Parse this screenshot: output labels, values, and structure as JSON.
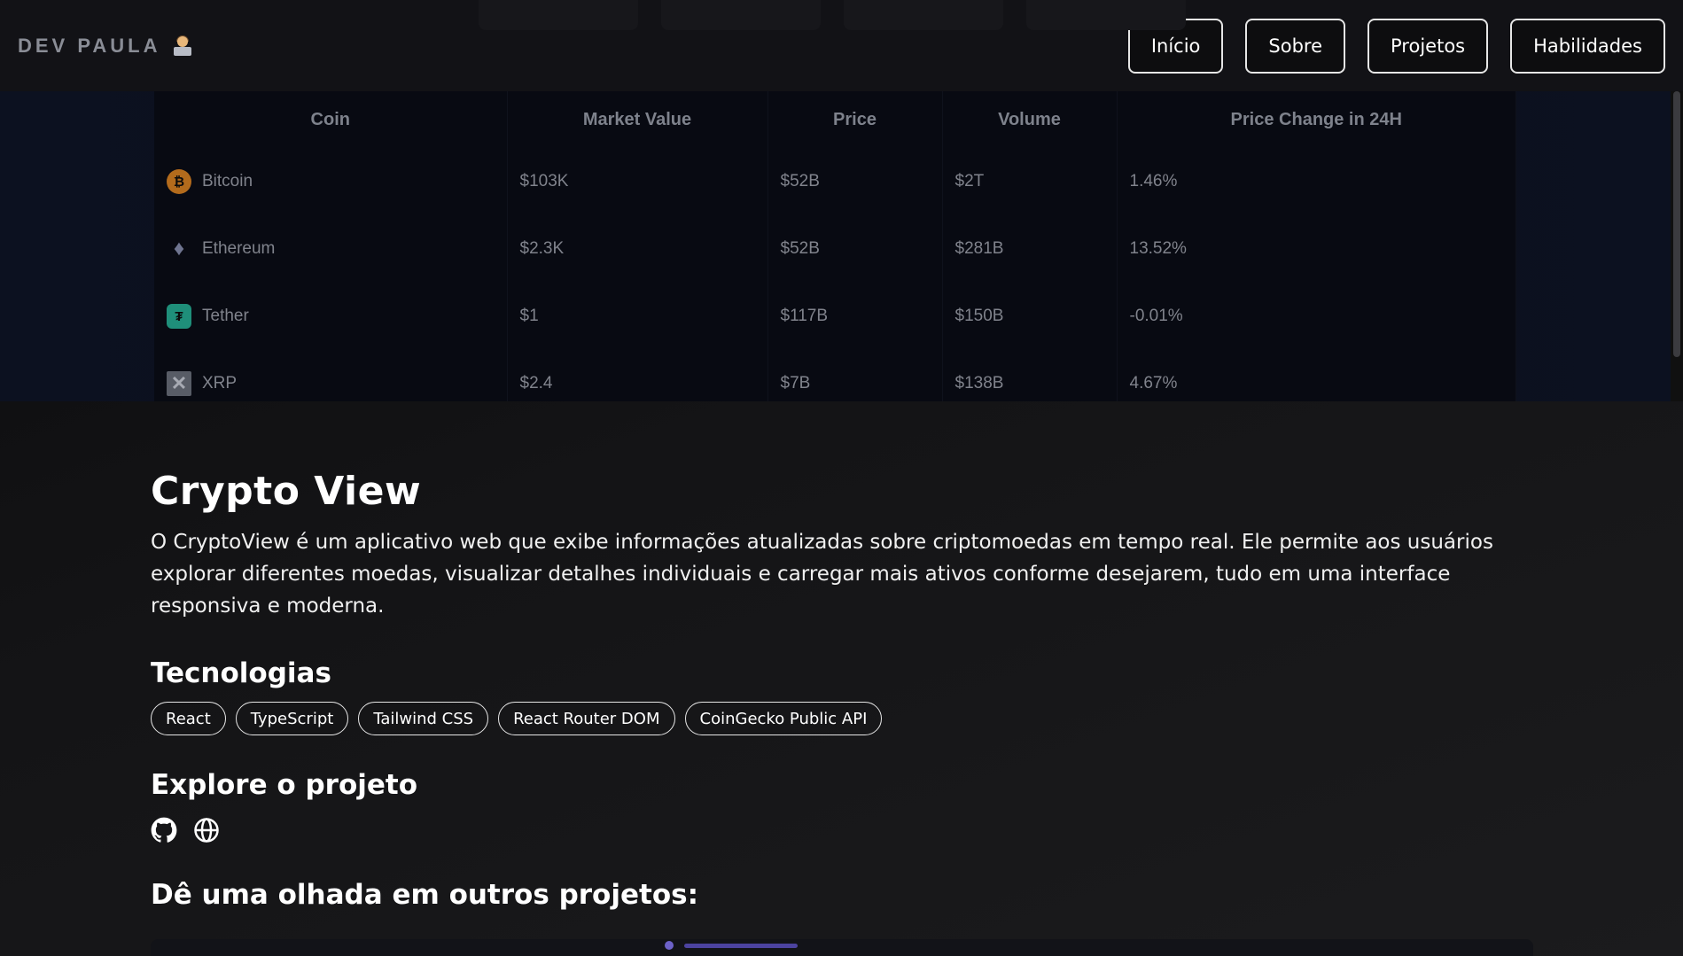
{
  "header": {
    "brand": "DEV PAULA",
    "nav": [
      "Início",
      "Sobre",
      "Projetos",
      "Habilidades"
    ]
  },
  "preview_table": {
    "columns": [
      "Coin",
      "Market Value",
      "Price",
      "Volume",
      "Price Change in 24H"
    ],
    "rows": [
      {
        "coin": "Bitcoin",
        "icon": "bitcoin-icon",
        "market_value": "$103K",
        "price": "$52B",
        "volume": "$2T",
        "change": "1.46%",
        "change_dir": "pos"
      },
      {
        "coin": "Ethereum",
        "icon": "ethereum-icon",
        "market_value": "$2.3K",
        "price": "$52B",
        "volume": "$281B",
        "change": "13.52%",
        "change_dir": "pos"
      },
      {
        "coin": "Tether",
        "icon": "tether-icon",
        "market_value": "$1",
        "price": "$117B",
        "volume": "$150B",
        "change": "-0.01%",
        "change_dir": "neg"
      },
      {
        "coin": "XRP",
        "icon": "xrp-icon",
        "market_value": "$2.4",
        "price": "$7B",
        "volume": "$138B",
        "change": "4.67%",
        "change_dir": "pos"
      }
    ]
  },
  "project": {
    "title": "Crypto View",
    "description": "O CryptoView é um aplicativo web que exibe informações atualizadas sobre criptomoedas em tempo real. Ele permite aos usuários explorar diferentes moedas, visualizar detalhes individuais e carregar mais ativos conforme desejarem, tudo em uma interface responsiva e moderna.",
    "tech_heading": "Tecnologias",
    "technologies": [
      "React",
      "TypeScript",
      "Tailwind CSS",
      "React Router DOM",
      "CoinGecko Public API"
    ],
    "explore_heading": "Explore o projeto",
    "others_heading": "Dê uma olhada em outros projetos:"
  },
  "colors": {
    "positive": "#1c7a34",
    "negative": "#8a1d1d",
    "slider_accent": "#6d62c9"
  }
}
